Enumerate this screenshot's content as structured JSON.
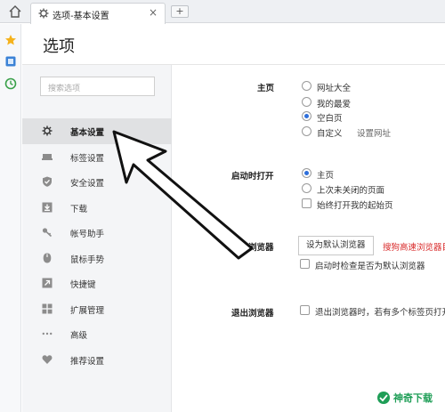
{
  "tabbar": {
    "tab_title": "选项-基本设置",
    "close_glyph": "×",
    "new_tab_glyph": "+"
  },
  "page": {
    "title": "选项"
  },
  "sidebar": {
    "search_placeholder": "搜索选项",
    "items": [
      {
        "label": "基本设置",
        "icon": "gear-icon",
        "active": true
      },
      {
        "label": "标签设置",
        "icon": "tab-icon"
      },
      {
        "label": "安全设置",
        "icon": "shield-check-icon"
      },
      {
        "label": "下载",
        "icon": "download-icon"
      },
      {
        "label": "帐号助手",
        "icon": "key-icon"
      },
      {
        "label": "鼠标手势",
        "icon": "mouse-icon"
      },
      {
        "label": "快捷键",
        "icon": "shortcut-icon"
      },
      {
        "label": "扩展管理",
        "icon": "extensions-icon"
      },
      {
        "label": "高级",
        "icon": "more-icon"
      },
      {
        "label": "推荐设置",
        "icon": "heart-icon"
      }
    ]
  },
  "homepage": {
    "label": "主页",
    "options": [
      {
        "label": "网址大全",
        "selected": false
      },
      {
        "label": "我的最爱",
        "selected": false
      },
      {
        "label": "空白页",
        "selected": true
      },
      {
        "label": "自定义",
        "selected": false
      }
    ],
    "set_url_link": "设置网址"
  },
  "startup": {
    "label": "启动时打开",
    "options": [
      {
        "label": "主页",
        "selected": true
      },
      {
        "label": "上次未关闭的页面",
        "selected": false
      }
    ],
    "always_open_label": "始终打开我的起始页"
  },
  "default_browser": {
    "label": "默认浏览器",
    "button": "设为默认浏览器",
    "warning": "搜狗高速浏览器目",
    "check_label": "启动时检查是否为默认浏览器"
  },
  "exit_browser": {
    "label": "退出浏览器",
    "check_label": "退出浏览器时，若有多个标签页打开"
  },
  "watermark": {
    "text": "神奇下载"
  },
  "colors": {
    "accent": "#2e6fdb",
    "warning": "#d92c2c",
    "watermark": "#1f9e57"
  }
}
